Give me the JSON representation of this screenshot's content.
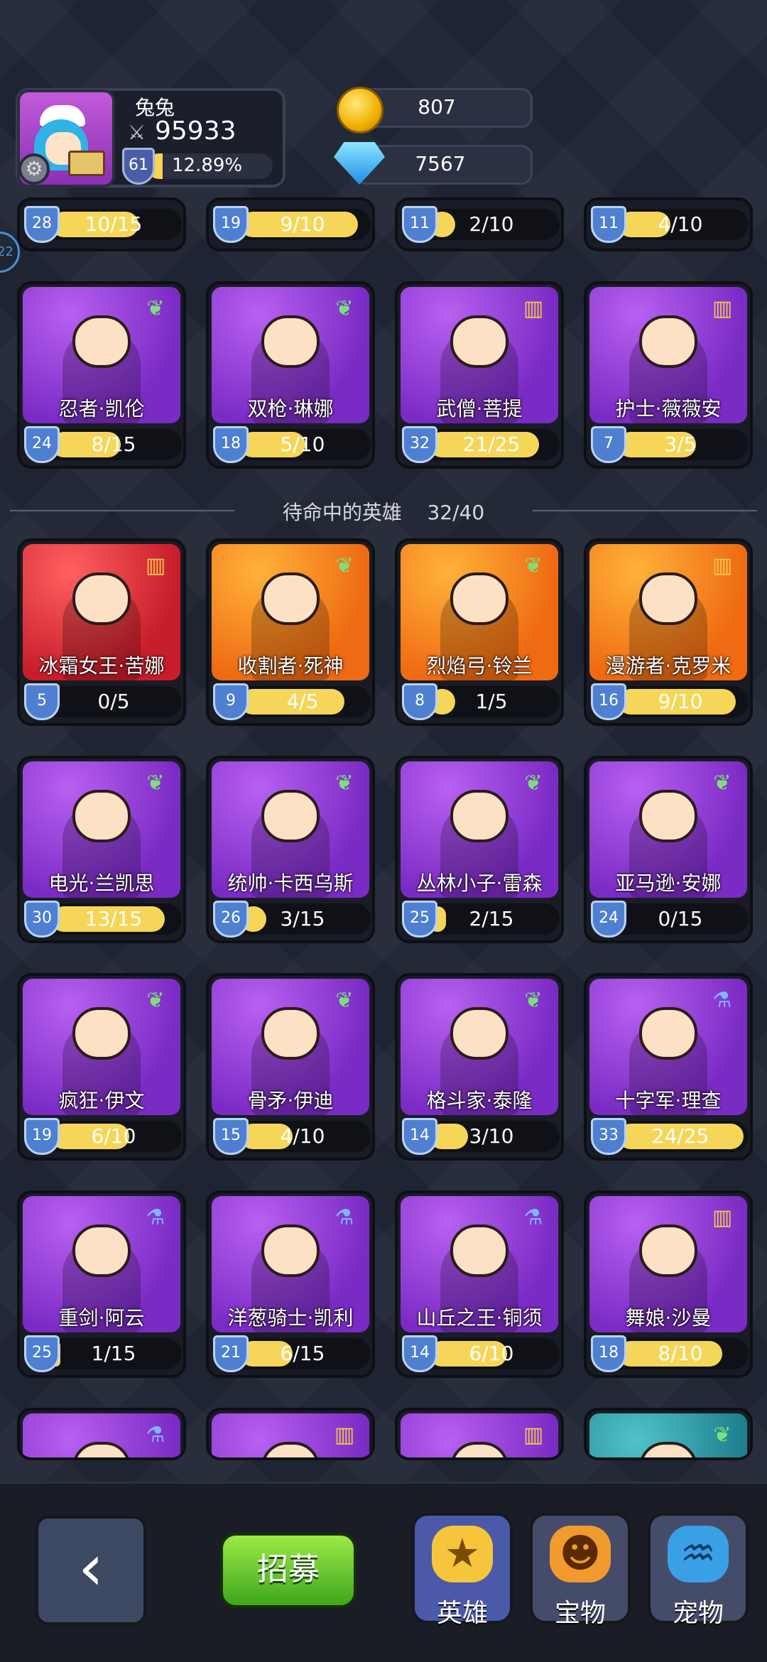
{
  "player": {
    "name": "兔兔",
    "power": "95933",
    "level": "61",
    "xp": "12.89%",
    "xp_fraction": 0.1289
  },
  "resources": {
    "gold": "807",
    "gems": "7567"
  },
  "divider": {
    "label": "待命中的英雄",
    "count": "32/40"
  },
  "side_indicator": "22",
  "top_partial": [
    {
      "level": "28",
      "progress": "10/15",
      "fill": 0.67
    },
    {
      "level": "19",
      "progress": "9/10",
      "fill": 0.9
    },
    {
      "level": "11",
      "progress": "2/10",
      "fill": 0.2
    },
    {
      "level": "11",
      "progress": "4/10",
      "fill": 0.4
    }
  ],
  "active_heroes": [
    {
      "name": "忍者·凯伦",
      "level": "24",
      "progress": "8/15",
      "fill": 0.53,
      "bg": "purple",
      "badge": "wing-icon"
    },
    {
      "name": "双枪·琳娜",
      "level": "18",
      "progress": "5/10",
      "fill": 0.5,
      "bg": "purple",
      "badge": "wing-icon"
    },
    {
      "name": "武僧·菩提",
      "level": "32",
      "progress": "21/25",
      "fill": 0.84,
      "bg": "purple",
      "badge": "book-icon"
    },
    {
      "name": "护士·薇薇安",
      "level": "7",
      "progress": "3/5",
      "fill": 0.6,
      "bg": "purple",
      "badge": "book-icon"
    }
  ],
  "standby_heroes": [
    {
      "name": "冰霜女王·苦娜",
      "level": "5",
      "progress": "0/5",
      "fill": 0,
      "bg": "red",
      "badge": "book-icon"
    },
    {
      "name": "收割者·死神",
      "level": "9",
      "progress": "4/5",
      "fill": 0.8,
      "bg": "orange",
      "badge": "wing-icon"
    },
    {
      "name": "烈焰弓·铃兰",
      "level": "8",
      "progress": "1/5",
      "fill": 0.2,
      "bg": "orange",
      "badge": "wing-icon"
    },
    {
      "name": "漫游者·克罗米",
      "level": "16",
      "progress": "9/10",
      "fill": 0.9,
      "bg": "orange",
      "badge": "book-icon"
    },
    {
      "name": "电光·兰凯思",
      "level": "30",
      "progress": "13/15",
      "fill": 0.87,
      "bg": "purple",
      "badge": "wing-icon"
    },
    {
      "name": "统帅·卡西乌斯",
      "level": "26",
      "progress": "3/15",
      "fill": 0.2,
      "bg": "purple",
      "badge": "wing-icon"
    },
    {
      "name": "丛林小子·雷森",
      "level": "25",
      "progress": "2/15",
      "fill": 0.13,
      "bg": "purple",
      "badge": "wing-icon"
    },
    {
      "name": "亚马逊·安娜",
      "level": "24",
      "progress": "0/15",
      "fill": 0,
      "bg": "purple",
      "badge": "wing-icon"
    },
    {
      "name": "疯狂·伊文",
      "level": "19",
      "progress": "6/10",
      "fill": 0.6,
      "bg": "purple",
      "badge": "wing-icon"
    },
    {
      "name": "骨矛·伊迪",
      "level": "15",
      "progress": "4/10",
      "fill": 0.4,
      "bg": "purple",
      "badge": "wing-icon"
    },
    {
      "name": "格斗家·泰隆",
      "level": "14",
      "progress": "3/10",
      "fill": 0.3,
      "bg": "purple",
      "badge": "wing-icon"
    },
    {
      "name": "十字军·理查",
      "level": "33",
      "progress": "24/25",
      "fill": 0.96,
      "bg": "purple",
      "badge": "potion-icon"
    },
    {
      "name": "重剑·阿云",
      "level": "25",
      "progress": "1/15",
      "fill": 0.07,
      "bg": "purple",
      "badge": "potion-icon"
    },
    {
      "name": "洋葱骑士·凯利",
      "level": "21",
      "progress": "6/15",
      "fill": 0.4,
      "bg": "purple",
      "badge": "potion-icon"
    },
    {
      "name": "山丘之王·铜须",
      "level": "14",
      "progress": "6/10",
      "fill": 0.6,
      "bg": "purple",
      "badge": "potion-icon"
    },
    {
      "name": "舞娘·沙曼",
      "level": "18",
      "progress": "8/10",
      "fill": 0.8,
      "bg": "purple",
      "badge": "book-icon"
    }
  ],
  "bottom_partial": [
    {
      "bg": "purple",
      "badge": "potion-icon"
    },
    {
      "bg": "purple",
      "badge": "book-icon"
    },
    {
      "bg": "purple",
      "badge": "book-icon"
    },
    {
      "bg": "teal",
      "badge": "wing-icon"
    }
  ],
  "nav": {
    "back": "‹",
    "recruit": "招募",
    "tabs": [
      {
        "label": "英雄",
        "icon": "hero-icon"
      },
      {
        "label": "宝物",
        "icon": "treasure-icon"
      },
      {
        "label": "宠物",
        "icon": "pet-icon"
      }
    ]
  }
}
